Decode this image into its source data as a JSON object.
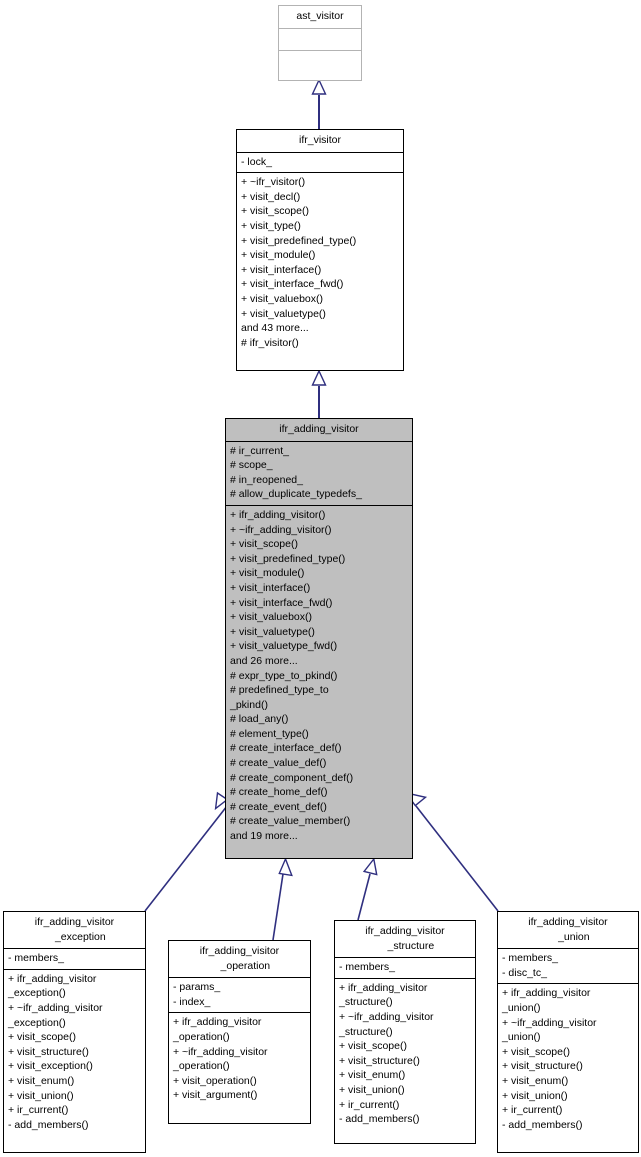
{
  "diagram": {
    "kind": "uml-class-inheritance-diagram",
    "colors": {
      "highlight_fill": "#bfbfbf",
      "node_fill": "#ffffff",
      "border": "#000000",
      "root_border": "#b3b3b3",
      "edge": "#2f2f7f",
      "text": "#000000"
    }
  },
  "nodes": {
    "ast_visitor": {
      "title": "ast_visitor",
      "attributes": [],
      "operations": []
    },
    "ifr_visitor": {
      "title": "ifr_visitor",
      "attributes": [
        "- lock_"
      ],
      "operations": [
        "+ ~ifr_visitor()",
        "+ visit_decl()",
        "+ visit_scope()",
        "+ visit_type()",
        "+ visit_predefined_type()",
        "+ visit_module()",
        "+ visit_interface()",
        "+ visit_interface_fwd()",
        "+ visit_valuebox()",
        "+ visit_valuetype()",
        "and 43 more...",
        "# ifr_visitor()"
      ]
    },
    "ifr_adding_visitor": {
      "title": "ifr_adding_visitor",
      "attributes": [
        "# ir_current_",
        "# scope_",
        "# in_reopened_",
        "# allow_duplicate_typedefs_"
      ],
      "operations": [
        "+ ifr_adding_visitor()",
        "+ ~ifr_adding_visitor()",
        "+ visit_scope()",
        "+ visit_predefined_type()",
        "+ visit_module()",
        "+ visit_interface()",
        "+ visit_interface_fwd()",
        "+ visit_valuebox()",
        "+ visit_valuetype()",
        "+ visit_valuetype_fwd()",
        "and 26 more...",
        "# expr_type_to_pkind()",
        "# predefined_type_to",
        "_pkind()",
        "# load_any()",
        "# element_type()",
        "# create_interface_def()",
        "# create_value_def()",
        "# create_component_def()",
        "# create_home_def()",
        "# create_event_def()",
        "# create_value_member()",
        "and 19 more..."
      ]
    },
    "ifr_adding_visitor_exception": {
      "title": "ifr_adding_visitor\n    _exception",
      "attributes": [
        "- members_"
      ],
      "operations": [
        "+ ifr_adding_visitor",
        "_exception()",
        "+ ~ifr_adding_visitor",
        "_exception()",
        "+ visit_scope()",
        "+ visit_structure()",
        "+ visit_exception()",
        "+ visit_enum()",
        "+ visit_union()",
        "+ ir_current()",
        "- add_members()"
      ]
    },
    "ifr_adding_visitor_operation": {
      "title": "ifr_adding_visitor\n    _operation",
      "attributes": [
        "- params_",
        "- index_"
      ],
      "operations": [
        "+ ifr_adding_visitor",
        "_operation()",
        "+ ~ifr_adding_visitor",
        "_operation()",
        "+ visit_operation()",
        "+ visit_argument()"
      ]
    },
    "ifr_adding_visitor_structure": {
      "title": "ifr_adding_visitor\n    _structure",
      "attributes": [
        "- members_"
      ],
      "operations": [
        "+ ifr_adding_visitor",
        "_structure()",
        "+ ~ifr_adding_visitor",
        "_structure()",
        "+ visit_scope()",
        "+ visit_structure()",
        "+ visit_enum()",
        "+ visit_union()",
        "+ ir_current()",
        "- add_members()"
      ]
    },
    "ifr_adding_visitor_union": {
      "title": "ifr_adding_visitor\n    _union",
      "attributes": [
        "- members_",
        "- disc_tc_"
      ],
      "operations": [
        "+ ifr_adding_visitor",
        "_union()",
        "+ ~ifr_adding_visitor",
        "_union()",
        "+ visit_scope()",
        "+ visit_structure()",
        "+ visit_enum()",
        "+ visit_union()",
        "+ ir_current()",
        "- add_members()"
      ]
    }
  },
  "edges": [
    {
      "from": "ifr_visitor",
      "to": "ast_visitor",
      "type": "generalization"
    },
    {
      "from": "ifr_adding_visitor",
      "to": "ifr_visitor",
      "type": "generalization"
    },
    {
      "from": "ifr_adding_visitor_exception",
      "to": "ifr_adding_visitor",
      "type": "generalization"
    },
    {
      "from": "ifr_adding_visitor_operation",
      "to": "ifr_adding_visitor",
      "type": "generalization"
    },
    {
      "from": "ifr_adding_visitor_structure",
      "to": "ifr_adding_visitor",
      "type": "generalization"
    },
    {
      "from": "ifr_adding_visitor_union",
      "to": "ifr_adding_visitor",
      "type": "generalization"
    }
  ]
}
